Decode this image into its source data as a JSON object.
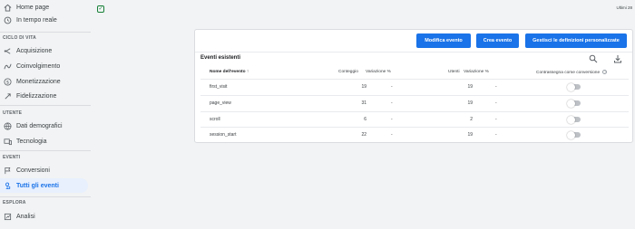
{
  "topbar": {
    "check_icon": "check-square-icon",
    "right_text": "Ultimi 28"
  },
  "sidebar": {
    "home": {
      "label": "Home page",
      "icon": "home-icon"
    },
    "realtime": {
      "label": "In tempo reale",
      "icon": "clock-icon"
    },
    "section_lifecycle": "CICLO DI VITA",
    "lifecycle": [
      {
        "label": "Acquisizione",
        "icon": "acquisition-icon"
      },
      {
        "label": "Coinvolgimento",
        "icon": "engagement-icon"
      },
      {
        "label": "Monetizzazione",
        "icon": "dollar-icon"
      },
      {
        "label": "Fidelizzazione",
        "icon": "retention-icon"
      }
    ],
    "section_user": "UTENTE",
    "user": [
      {
        "label": "Dati demografici",
        "icon": "globe-icon"
      },
      {
        "label": "Tecnologia",
        "icon": "devices-icon"
      }
    ],
    "section_events": "EVENTI",
    "events": [
      {
        "label": "Conversioni",
        "icon": "flag-icon"
      },
      {
        "label": "Tutti gli eventi",
        "icon": "touch-icon"
      }
    ],
    "section_explore": "ESPLORA",
    "explore": [
      {
        "label": "Analisi",
        "icon": "analysis-icon"
      }
    ]
  },
  "card": {
    "buttons": {
      "modify": "Modifica evento",
      "create": "Crea evento",
      "manage": "Gestisci le definizioni personalizzate"
    },
    "title": "Eventi esistenti",
    "columns": {
      "name": "Nome dell'evento",
      "count": "Conteggio",
      "count_change": "Variazione %",
      "users": "Utenti",
      "users_change": "Variazione %",
      "conversion": "Contrassegna come conversione"
    },
    "rows": [
      {
        "name": "first_visit",
        "count": "19",
        "count_change": "-",
        "users": "19",
        "users_change": "-"
      },
      {
        "name": "page_view",
        "count": "31",
        "count_change": "-",
        "users": "19",
        "users_change": "-"
      },
      {
        "name": "scroll",
        "count": "6",
        "count_change": "-",
        "users": "2",
        "users_change": "-"
      },
      {
        "name": "session_start",
        "count": "22",
        "count_change": "-",
        "users": "19",
        "users_change": "-"
      }
    ]
  }
}
